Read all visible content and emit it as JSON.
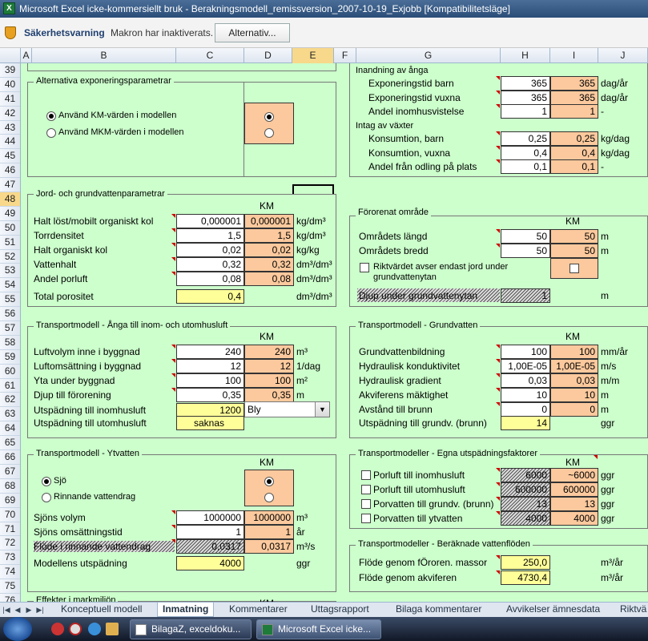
{
  "window": {
    "title": "Microsoft Excel icke-kommersiellt bruk - Berakningsmodell_remissversion_2007-10-19_Exjobb  [Kompatibilitetsläge]"
  },
  "message_bar": {
    "title": "Säkerhetsvarning",
    "text": "Makron har inaktiverats.",
    "button": "Alternativ..."
  },
  "columns": [
    "A",
    "B",
    "C",
    "D",
    "E",
    "F",
    "G",
    "H",
    "I",
    "J"
  ],
  "rows": [
    "39",
    "40",
    "41",
    "42",
    "43",
    "44",
    "45",
    "46",
    "47",
    "48",
    "49",
    "50",
    "51",
    "52",
    "53",
    "54",
    "55",
    "56",
    "57",
    "58",
    "59",
    "60",
    "61",
    "62",
    "63",
    "64",
    "65",
    "66",
    "67",
    "68",
    "69",
    "70",
    "71",
    "72",
    "73",
    "74",
    "75",
    "76"
  ],
  "exposure": {
    "title": "Alternativa exponeringsparametrar",
    "opt_km": "Använd KM-värden i modellen",
    "opt_mkm": "Använd MKM-värden i modellen"
  },
  "inhal": {
    "section": "Inandning av ånga",
    "rows": [
      {
        "label": "Exponeringstid barn",
        "v1": "365",
        "v2": "365",
        "unit": "dag/år"
      },
      {
        "label": "Exponeringstid vuxna",
        "v1": "365",
        "v2": "365",
        "unit": "dag/år"
      },
      {
        "label": "Andel inomhusvistelse",
        "v1": "1",
        "v2": "1",
        "unit": "-"
      }
    ]
  },
  "veg": {
    "section": "Intag av växter",
    "rows": [
      {
        "label": "Konsumtion, barn",
        "v1": "0,25",
        "v2": "0,25",
        "unit": "kg/dag"
      },
      {
        "label": "Konsumtion, vuxna",
        "v1": "0,4",
        "v2": "0,4",
        "unit": "kg/dag"
      },
      {
        "label": "Andel från odling på plats",
        "v1": "0,1",
        "v2": "0,1",
        "unit": "-"
      }
    ]
  },
  "soil": {
    "title": "Jord- och grundvattenparametrar",
    "km": "KM",
    "rows": [
      {
        "label": "Halt löst/mobilt organiskt kol",
        "v1": "0,000001",
        "v2": "0,000001",
        "unit": "kg/dm³"
      },
      {
        "label": "Torrdensitet",
        "v1": "1,5",
        "v2": "1,5",
        "unit": "kg/dm³"
      },
      {
        "label": "Halt organiskt kol",
        "v1": "0,02",
        "v2": "0,02",
        "unit": "kg/kg"
      },
      {
        "label": "Vattenhalt",
        "v1": "0,32",
        "v2": "0,32",
        "unit": "dm³/dm³"
      },
      {
        "label": "Andel porluft",
        "v1": "0,08",
        "v2": "0,08",
        "unit": "dm³/dm³"
      }
    ],
    "total_label": "Total porositet",
    "total_value": "0,4",
    "total_unit": "dm³/dm³"
  },
  "area": {
    "title": "Förorenat område",
    "km": "KM",
    "rows": [
      {
        "label": "Områdets längd",
        "v1": "50",
        "v2": "50",
        "unit": "m"
      },
      {
        "label": "Områdets bredd",
        "v1": "50",
        "v2": "50",
        "unit": "m"
      }
    ],
    "check_label_1": "Riktvärdet avser endast jord under",
    "check_label_2": "grundvattenytan",
    "depth_label": "Djup under grundvattenytan",
    "depth_value": "1",
    "depth_unit": "m"
  },
  "vapor": {
    "title": "Transportmodell - Ånga till inom- och utomhusluft",
    "km": "KM",
    "rows": [
      {
        "label": "Luftvolym inne i byggnad",
        "v1": "240",
        "v2": "240",
        "unit": "m³"
      },
      {
        "label": "Luftomsättning i byggnad",
        "v1": "12",
        "v2": "12",
        "unit": "1/dag"
      },
      {
        "label": "Yta under byggnad",
        "v1": "100",
        "v2": "100",
        "unit": "m²"
      },
      {
        "label": "Djup till förorening",
        "v1": "0,35",
        "v2": "0,35",
        "unit": "m"
      }
    ],
    "dil_in_label": "Utspädning till inomhusluft",
    "dil_in_value": "1200",
    "dropdown": "Bly",
    "dil_out_label": "Utspädning till utomhusluft",
    "dil_out_value": "saknas"
  },
  "gw": {
    "title": "Transportmodell - Grundvatten",
    "km": "KM",
    "rows": [
      {
        "label": "Grundvattenbildning",
        "v1": "100",
        "v2": "100",
        "unit": "mm/år"
      },
      {
        "label": "Hydraulisk konduktivitet",
        "v1": "1,00E-05",
        "v2": "1,00E-05",
        "unit": "m/s"
      },
      {
        "label": "Hydraulisk gradient",
        "v1": "0,03",
        "v2": "0,03",
        "unit": "m/m"
      },
      {
        "label": "Akviferens mäktighet",
        "v1": "10",
        "v2": "10",
        "unit": "m"
      },
      {
        "label": "Avstånd till brunn",
        "v1": "0",
        "v2": "0",
        "unit": "m"
      }
    ],
    "dil_label": "Utspädning till grundv. (brunn)",
    "dil_value": "14",
    "dil_unit": "ggr"
  },
  "surface": {
    "title": "Transportmodell - Ytvatten",
    "km": "KM",
    "opt_lake": "Sjö",
    "opt_stream": "Rinnande vattendrag",
    "rows": [
      {
        "label": "Sjöns volym",
        "v1": "1000000",
        "v2": "1000000",
        "unit": "m³"
      },
      {
        "label": "Sjöns omsättningstid",
        "v1": "1",
        "v2": "1",
        "unit": "år"
      },
      {
        "label": "Flöde i rinnande vattendrag",
        "v1": "0,0317",
        "v2": "0,0317",
        "unit": "m³/s"
      }
    ],
    "model_label": "Modellens utspädning",
    "model_value": "4000",
    "model_unit": "ggr"
  },
  "own": {
    "title": "Transportmodeller - Egna utspädningsfaktorer",
    "km": "KM",
    "rows": [
      {
        "label": "Porluft till inomhusluft",
        "v1": "6000",
        "v2": "~6000",
        "unit": "ggr"
      },
      {
        "label": "Porluft till utomhusluft",
        "v1": "600000",
        "v2": "600000",
        "unit": "ggr"
      },
      {
        "label": "Porvatten till grundv. (brunn)",
        "v1": "13",
        "v2": "13",
        "unit": "ggr"
      },
      {
        "label": "Porvatten till ytvatten",
        "v1": "4000",
        "v2": "4000",
        "unit": "ggr"
      }
    ]
  },
  "flows": {
    "title": "Transportmodeller - Beräknade vattenflöden",
    "rows": [
      {
        "label": "Flöde genom fÖroren. massor",
        "value": "250,0",
        "unit": "m³/år"
      },
      {
        "label": "Flöde genom akviferen",
        "value": "4730,4",
        "unit": "m³/år"
      }
    ]
  },
  "effects": {
    "title": "Effekter i markmiljön",
    "km": "KM"
  },
  "tabs": [
    "Konceptuell modell",
    "Inmatning",
    "Kommentarer",
    "Uttagsrapport",
    "Bilaga kommentarer",
    "Avvikelser ämnesdata",
    "Riktvä"
  ],
  "taskbar": {
    "item1": "BilagaZ, exceldoku...",
    "item2": "Microsoft Excel icke..."
  }
}
